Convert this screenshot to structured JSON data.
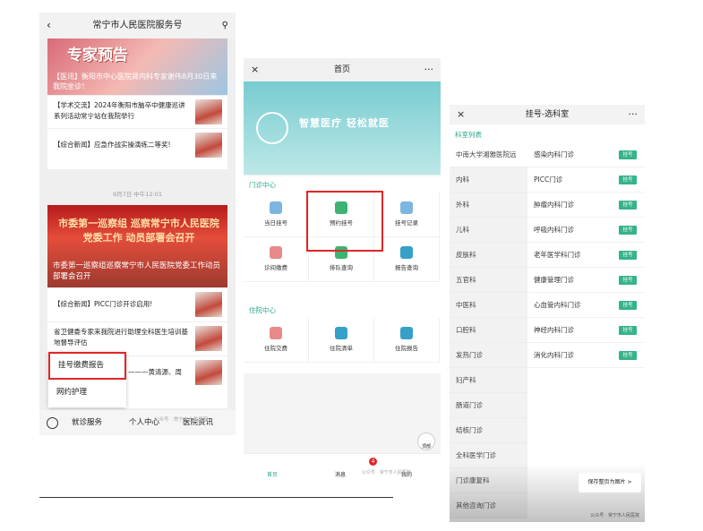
{
  "panel1": {
    "title": "常宁市人民医院服务号",
    "banner_big": "专家预告",
    "banner_caption": "【医讯】衡阳市中心医院肾内科专家谢伟8月30日来我院坐诊！",
    "items": [
      "【学术交流】2024年衡阳市脑卒中健康巡讲系列活动常宁站在我院举行",
      "【综合新闻】应急作战实操演练二等奖!"
    ],
    "date": "9月7日 中午12:01",
    "banner2_head": "市委第一巡察组 巡察常宁市人民医院党委工作 动员部署会召开",
    "banner2_caption": "市委第一巡察组巡察常宁市人民医院党委工作动员部署会召开",
    "items2": [
      "【综合新闻】PICC门诊开诊启用!",
      "省卫健委专家来我院进行助理全科医生培训基地督导评估",
      "———黄清源、周"
    ],
    "popup": [
      "挂号缴费报告",
      "网约护理"
    ],
    "bottom_menu": [
      "就诊服务",
      "个人中心",
      "医院资讯"
    ],
    "watermark": "公众号 · 常宁市人民医院"
  },
  "panel2": {
    "title": "首页",
    "slogan": "智慧医疗 轻松就医",
    "section1": "门诊中心",
    "outpatient": [
      "当日挂号",
      "预约挂号",
      "挂号记录",
      "诊间缴费",
      "排队查询",
      "报告查询"
    ],
    "section2": "住院中心",
    "inpatient": [
      "住院交费",
      "住院清单",
      "住院报告"
    ],
    "tabs": [
      "首页",
      "消息",
      "我的"
    ],
    "msg_badge": "4",
    "top_label": "顶部",
    "watermark": "公众号 · 常宁市人民医院"
  },
  "panel3": {
    "title": "挂号-选科室",
    "section": "科室列表",
    "departments": [
      "中南大学湘雅医院远",
      "内科",
      "外科",
      "儿科",
      "皮肤科",
      "五官科",
      "中医科",
      "口腔科",
      "发热门诊",
      "妇产科",
      "肠道门诊",
      "结核门诊",
      "全科医学门诊",
      "门诊康复科",
      "其他咨询门诊"
    ],
    "clinics": [
      "感染内科门诊",
      "PICC门诊",
      "肿瘤内科门诊",
      "呼吸内科门诊",
      "老年医学科门诊",
      "健康管理门诊",
      "心血管内科门诊",
      "神经内科门诊",
      "消化内科门诊"
    ],
    "tag": "挂号",
    "save": "保存整页为图片 >",
    "watermark": "公众号 · 常宁市人民医院"
  },
  "colors": {
    "accent": "#36b38a",
    "highlight": "#e02626",
    "hero": "#78ccd1"
  }
}
